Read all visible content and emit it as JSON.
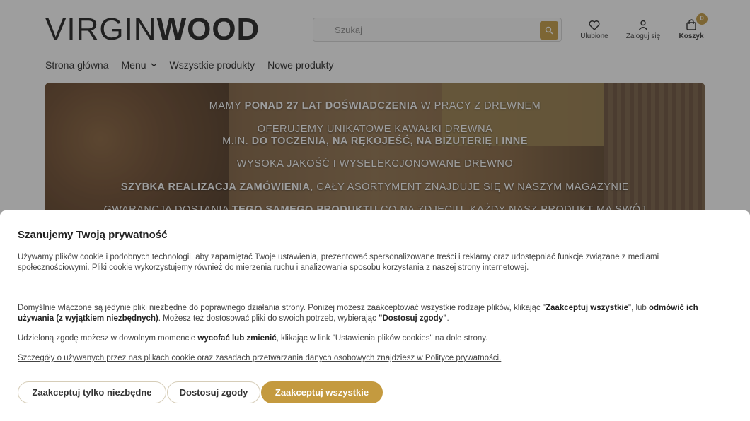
{
  "header": {
    "logo_light": "VIRGIN",
    "logo_bold": "WOOD",
    "search_placeholder": "Szukaj",
    "favorites_label": "Ulubione",
    "login_label": "Zaloguj się",
    "cart_label": "Koszyk",
    "cart_count": "0",
    "accent_color": "#c49a3f"
  },
  "nav": {
    "items": [
      "Strona główna",
      "Menu",
      "Wszystkie produkty",
      "Nowe produkty"
    ]
  },
  "banner": {
    "line1_pre": "MAMY ",
    "line1_bold": "PONAD 27 LAT DOŚWIADCZENIA",
    "line1_post": " W PRACY Z DREWNEM",
    "line2": "OFERUJEMY UNIKATOWE KAWAŁKI DREWNA",
    "line3_pre": "M.IN. ",
    "line3_bold": "DO TOCZENIA, NA RĘKOJEŚĆ, NA BIŻUTERIĘ I INNE",
    "line4": "WYSOKA JAKOŚĆ I WYSELEKCJONOWANE DREWNO",
    "line5_bold": "SZYBKA REALIZACJA ZAMÓWIENIA",
    "line5_post": ", CAŁY ASORTYMENT ZNAJDUJE SIĘ W NASZYM MAGAZYNIE",
    "line6_pre": "GWARANCJA DOSTANIA ",
    "line6_bold": "TEGO SAMEGO PRODUKTU",
    "line6_post": " CO NA ZDJĘCIU, KAŻDY NASZ PRODUKT MA SWÓJ"
  },
  "cookie": {
    "title": "Szanujemy Twoją prywatność",
    "p1": "Używamy plików cookie i podobnych technologii, aby zapamiętać Twoje ustawienia, prezentować spersonalizowane treści i reklamy oraz udostępniać funkcje związane z mediami społecznościowymi. Pliki cookie wykorzystujemy również do mierzenia ruchu i analizowania sposobu korzystania z naszej strony internetowej.",
    "p2_a": "Domyślnie włączone są jedynie pliki niezbędne do poprawnego działania strony. Poniżej możesz zaakceptować wszystkie rodzaje plików, klikając \"",
    "p2_b": "Zaakceptuj wszystkie",
    "p2_c": "\", lub ",
    "p2_d": "odmówić ich używania (z wyjątkiem niezbędnych)",
    "p2_e": ". Możesz też dostosować pliki do swoich potrzeb, wybierając ",
    "p2_f": "\"Dostosuj zgody\"",
    "p2_g": ".",
    "p3_a": "Udzieloną zgodę możesz w dowolnym momencie ",
    "p3_b": "wycofać lub zmienić",
    "p3_c": ", klikając w link \"Ustawienia plików cookies\" na dole strony.",
    "p4": "Szczegóły o używanych przez nas plikach cookie oraz zasadach przetwarzania danych osobowych znajdziesz w Polityce prywatności.",
    "btn_necessary": "Zaakceptuj tylko niezbędne",
    "btn_customize": "Dostosuj zgody",
    "btn_accept_all": "Zaakceptuj wszystkie"
  }
}
